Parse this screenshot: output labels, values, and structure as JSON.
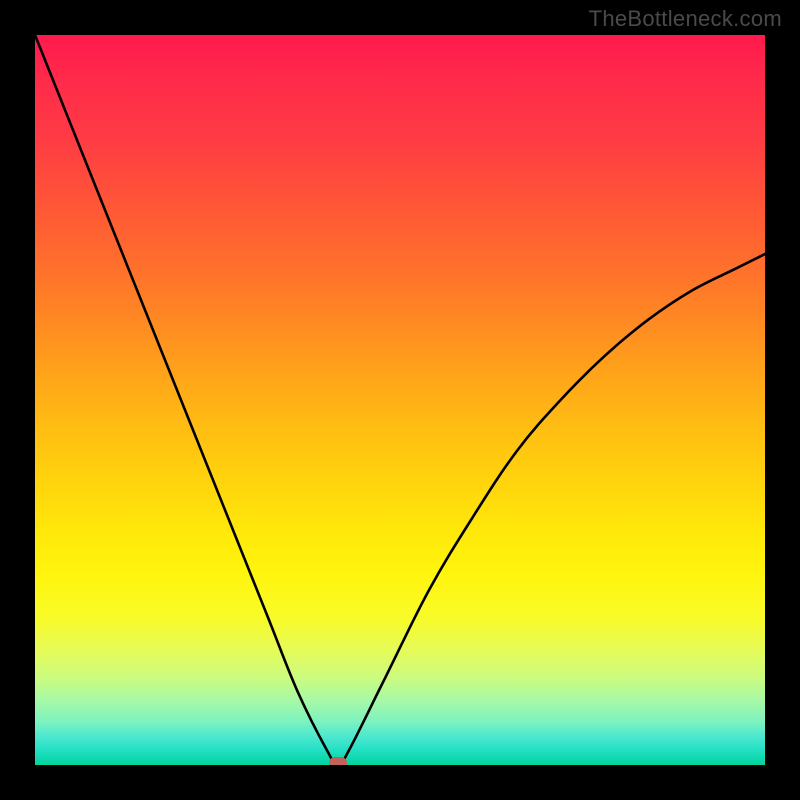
{
  "watermark": "TheBottleneck.com",
  "colors": {
    "frame": "#000000",
    "curve": "#000000",
    "marker": "#c0635a"
  },
  "chart_data": {
    "type": "line",
    "title": "",
    "xlabel": "",
    "ylabel": "",
    "xlim": [
      0,
      100
    ],
    "ylim": [
      0,
      100
    ],
    "grid": false,
    "legend": false,
    "series": [
      {
        "name": "bottleneck-curve",
        "x": [
          0,
          4,
          8,
          12,
          16,
          20,
          24,
          28,
          32,
          36,
          40,
          41.5,
          43,
          48,
          54,
          60,
          66,
          72,
          78,
          84,
          90,
          96,
          100
        ],
        "y": [
          100,
          90,
          80,
          70,
          60,
          50,
          40,
          30,
          20,
          10,
          2,
          0,
          2,
          12,
          24,
          34,
          43,
          50,
          56,
          61,
          65,
          68,
          70
        ]
      }
    ],
    "marker": {
      "x": 41.5,
      "y": 0
    },
    "background_gradient": {
      "direction": "top-to-bottom",
      "stops": [
        {
          "pos": 0,
          "color": "#ff1a4d"
        },
        {
          "pos": 50,
          "color": "#ffbe12"
        },
        {
          "pos": 80,
          "color": "#f8fb2a"
        },
        {
          "pos": 100,
          "color": "#00d49a"
        }
      ]
    }
  }
}
